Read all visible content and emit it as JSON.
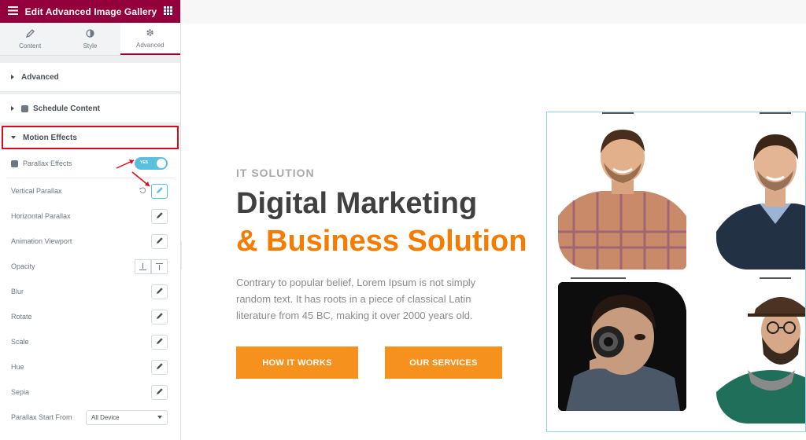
{
  "editor": {
    "title": "Edit Advanced Image Gallery",
    "tabs": [
      {
        "label": "Content",
        "icon": "pencil-icon"
      },
      {
        "label": "Style",
        "icon": "contrast-icon"
      },
      {
        "label": "Advanced",
        "icon": "gear-icon"
      }
    ],
    "sections": {
      "advanced": "Advanced",
      "schedule": "Schedule Content",
      "motion": "Motion Effects"
    },
    "controls": {
      "parallax_effects": "Parallax Effects",
      "toggle_label": "YES",
      "vertical_parallax": "Vertical Parallax",
      "horizontal_parallax": "Horizontal Parallax",
      "animation_viewport": "Animation Viewport",
      "opacity": "Opacity",
      "blur": "Blur",
      "rotate": "Rotate",
      "scale": "Scale",
      "hue": "Hue",
      "sepia": "Sepia",
      "parallax_start_from": "Parallax Start From",
      "start_from_value": "All Device"
    }
  },
  "preview": {
    "kicker": "IT SOLUTION",
    "heading_line1": "Digital Marketing",
    "heading_line2": "& Business Solution",
    "paragraph": "Contrary to popular belief, Lorem Ipsum is not simply random text. It has roots in a piece of classical Latin literature from 45 BC, making it over 2000 years old.",
    "button1": "HOW IT WORKS",
    "button2": "OUR SERVICES"
  },
  "colors": {
    "brand": "#93003c",
    "accent_orange": "#f7911e",
    "toggle_on": "#5bc0de",
    "highlight_red": "#e0061c"
  }
}
